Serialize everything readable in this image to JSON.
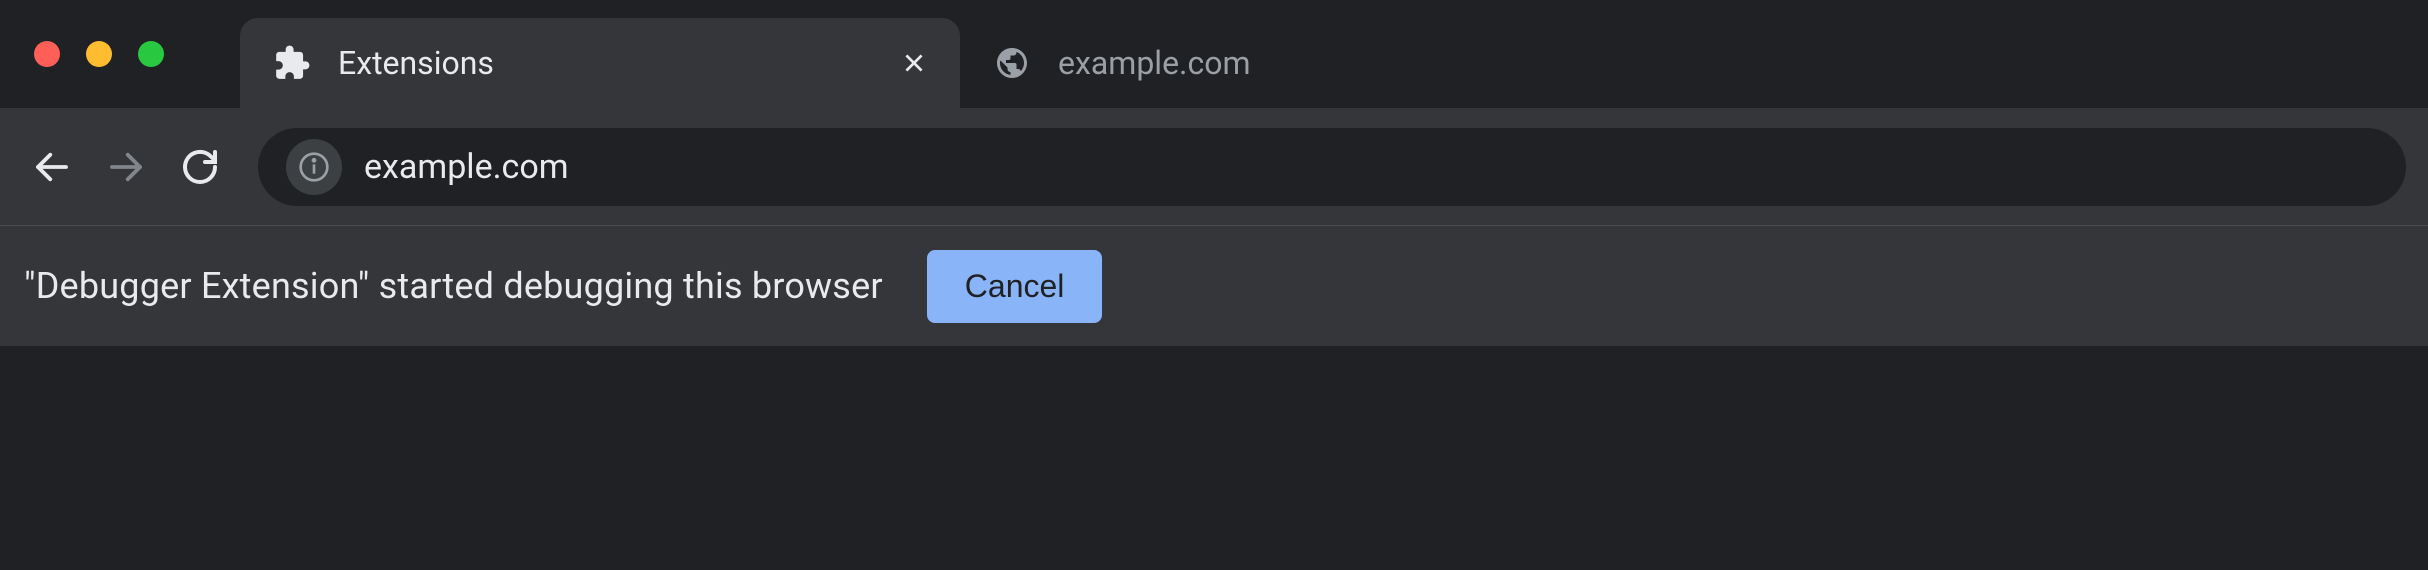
{
  "tabs": [
    {
      "title": "Extensions",
      "icon": "extension-icon",
      "active": true,
      "closable": true
    },
    {
      "title": "example.com",
      "icon": "globe-icon",
      "active": false,
      "closable": false
    }
  ],
  "address_bar": {
    "url": "example.com"
  },
  "infobar": {
    "message": "\"Debugger Extension\" started debugging this browser",
    "cancel_label": "Cancel"
  }
}
